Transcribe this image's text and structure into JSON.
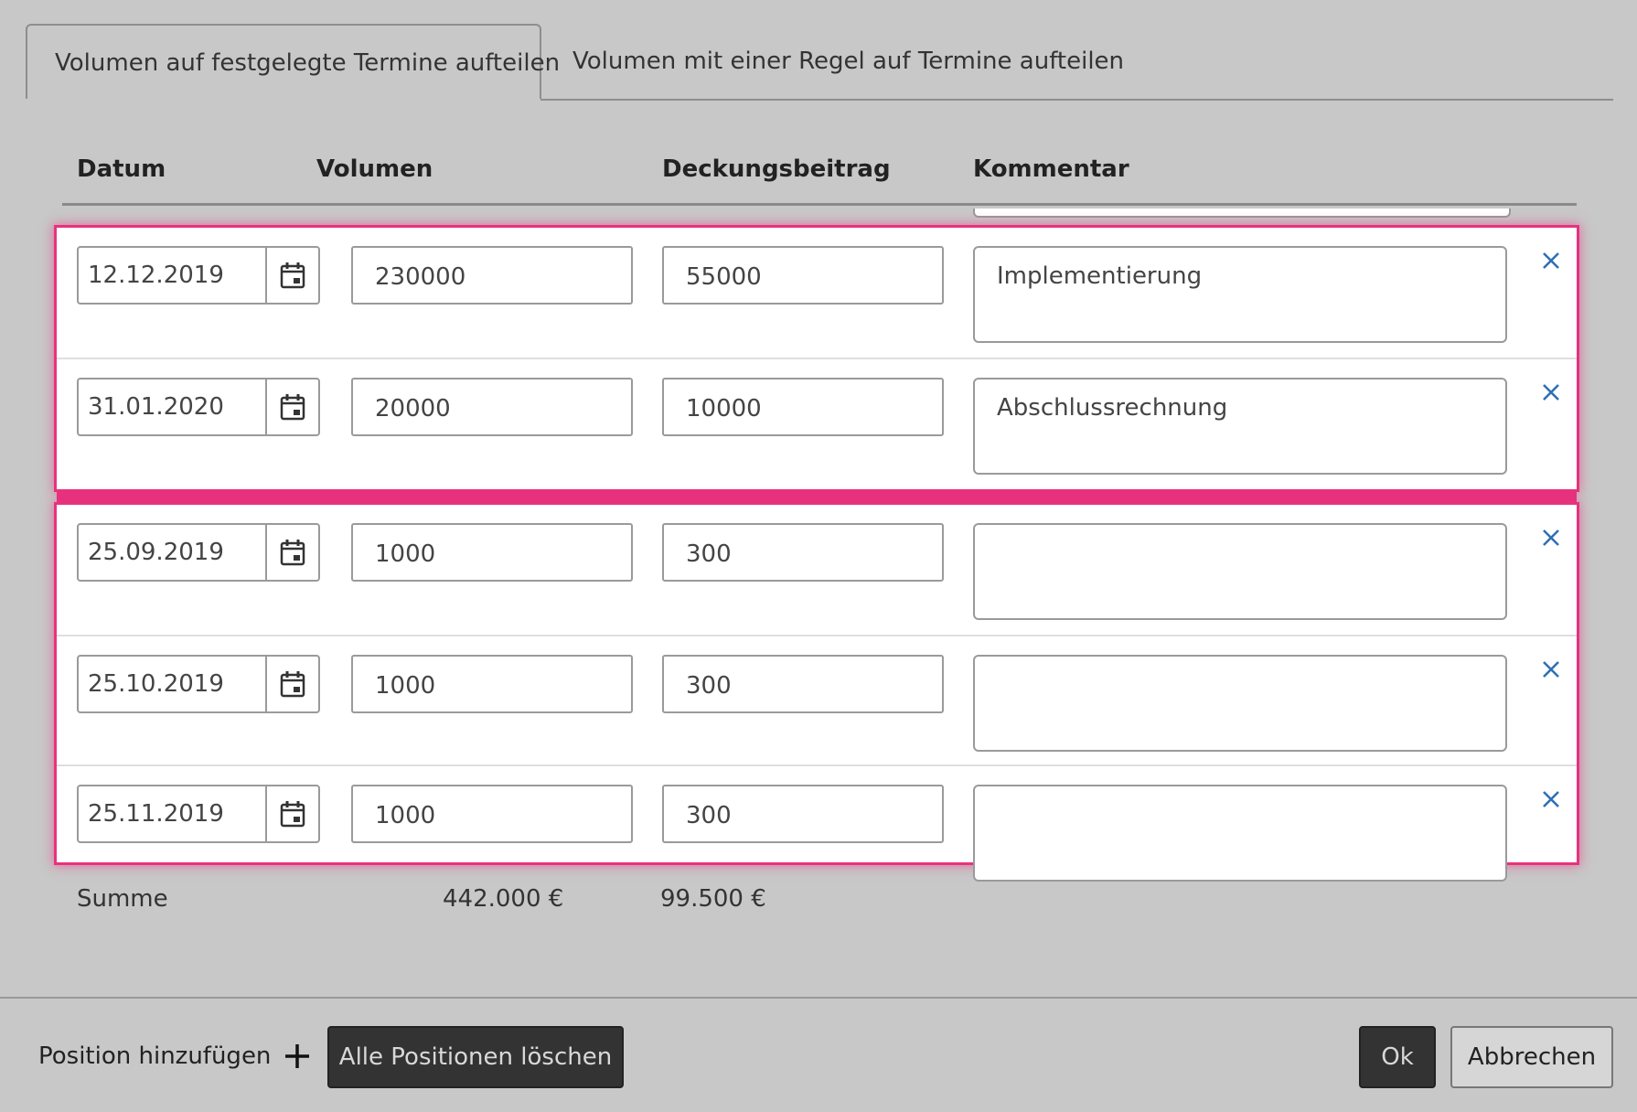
{
  "tabs": {
    "fixed": "Volumen auf festgelegte Termine aufteilen",
    "rule": "Volumen mit einer Regel auf Termine aufteilen"
  },
  "columns": {
    "date": "Datum",
    "volume": "Volumen",
    "margin": "Deckungsbeitrag",
    "comment": "Kommentar"
  },
  "rows": [
    {
      "date": "12.12.2019",
      "volume": "230000",
      "margin": "55000",
      "comment": "Implementierung"
    },
    {
      "date": "31.01.2020",
      "volume": "20000",
      "margin": "10000",
      "comment": "Abschlussrechnung"
    },
    {
      "date": "25.09.2019",
      "volume": "1000",
      "margin": "300",
      "comment": ""
    },
    {
      "date": "25.10.2019",
      "volume": "1000",
      "margin": "300",
      "comment": ""
    },
    {
      "date": "25.11.2019",
      "volume": "1000",
      "margin": "300",
      "comment": ""
    }
  ],
  "summary": {
    "label": "Summe",
    "volume": "442.000 €",
    "margin": "99.500 €"
  },
  "footer": {
    "add_position": "Position hinzufügen",
    "delete_all": "Alle Positionen löschen",
    "ok": "Ok",
    "cancel": "Abbrechen"
  },
  "colors": {
    "highlight": "#e8327d",
    "delete_icon": "#2f6fb5",
    "background": "#c8c8c8"
  },
  "icons": {
    "calendar": "calendar-icon",
    "delete": "close-icon",
    "add": "plus-icon"
  }
}
